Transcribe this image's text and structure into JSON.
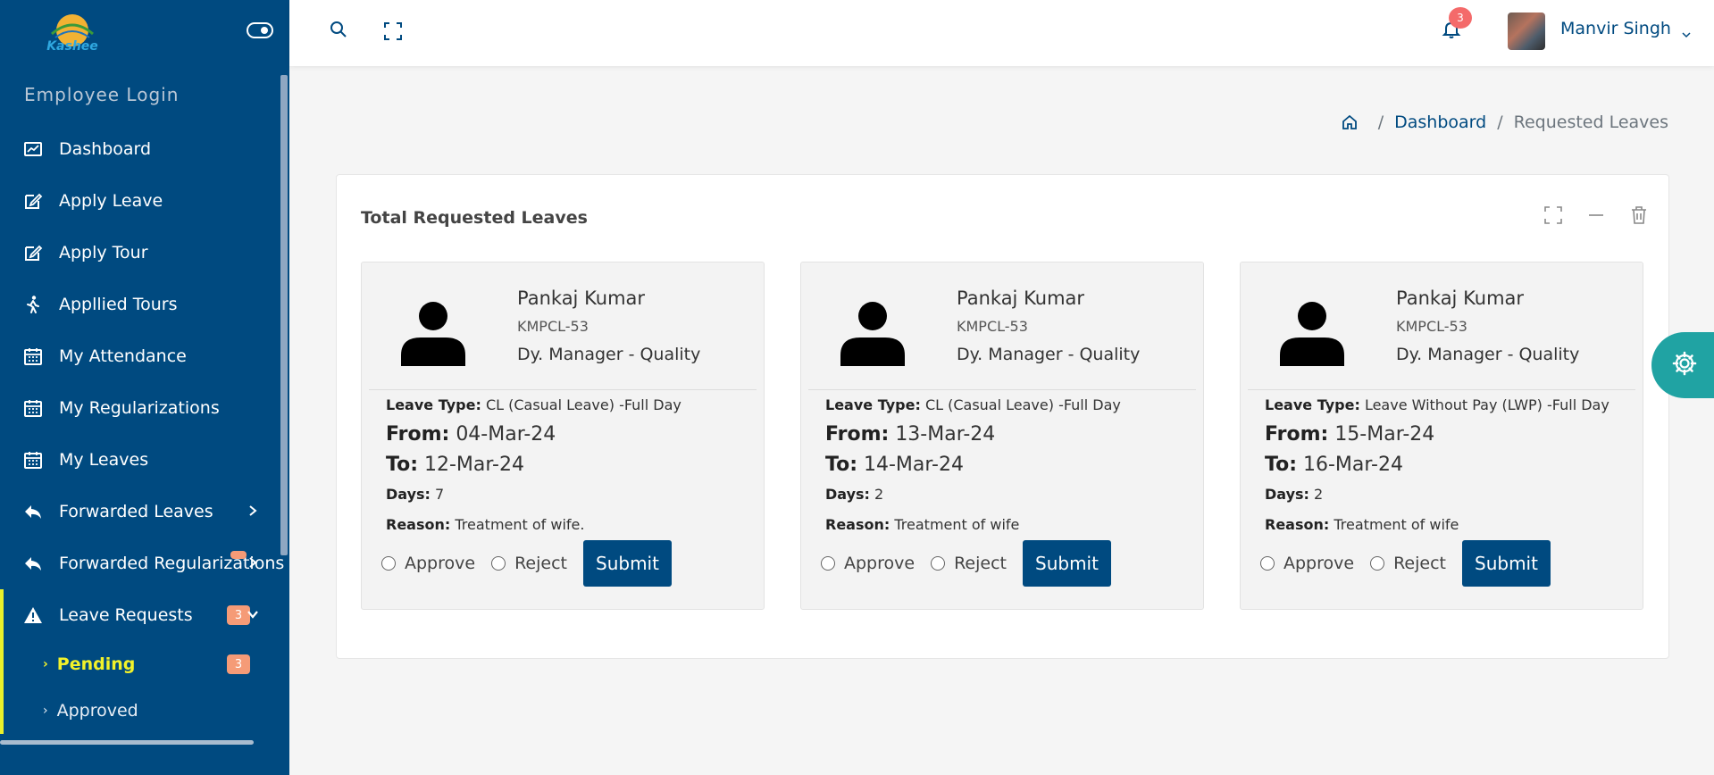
{
  "sidebar": {
    "logo_text": "Kashee",
    "section_label": "Employee Login",
    "items": [
      {
        "label": "Dashboard"
      },
      {
        "label": "Apply Leave"
      },
      {
        "label": "Apply Tour"
      },
      {
        "label": "Appllied Tours"
      },
      {
        "label": "My Attendance"
      },
      {
        "label": "My Regularizations"
      },
      {
        "label": "My Leaves"
      },
      {
        "label": "Forwarded Leaves"
      },
      {
        "label": "Forwarded Regularizations"
      },
      {
        "label": "Leave Requests",
        "badge": "3"
      }
    ],
    "sub_items": [
      {
        "label": "Pending",
        "badge": "3"
      },
      {
        "label": "Approved"
      }
    ]
  },
  "topbar": {
    "notification_count": "3",
    "user_name": "Manvir Singh"
  },
  "breadcrumb": {
    "items": [
      "Dashboard",
      "Requested Leaves"
    ]
  },
  "card": {
    "title": "Total Requested Leaves"
  },
  "labels": {
    "leave_type": "Leave Type:",
    "from": "From:",
    "to": "To:",
    "days": "Days:",
    "reason": "Reason:",
    "approve": "Approve",
    "reject": "Reject",
    "submit": "Submit"
  },
  "requests": [
    {
      "name": "Pankaj Kumar",
      "code": "KMPCL-53",
      "designation": "Dy. Manager - Quality",
      "leave_type": "CL (Casual Leave) -Full Day",
      "from": "04-Mar-24",
      "to": "12-Mar-24",
      "days": "7",
      "reason": "Treatment of wife."
    },
    {
      "name": "Pankaj Kumar",
      "code": "KMPCL-53",
      "designation": "Dy. Manager - Quality",
      "leave_type": "CL (Casual Leave) -Full Day",
      "from": "13-Mar-24",
      "to": "14-Mar-24",
      "days": "2",
      "reason": "Treatment of wife"
    },
    {
      "name": "Pankaj Kumar",
      "code": "KMPCL-53",
      "designation": "Dy. Manager - Quality",
      "leave_type": "Leave Without Pay (LWP) -Full Day",
      "from": "15-Mar-24",
      "to": "16-Mar-24",
      "days": "2",
      "reason": "Treatment of wife"
    }
  ],
  "colors": {
    "sidebar_bg": "#004a80",
    "active_accent": "#e9f02b",
    "badge": "#f59b77",
    "settings_tab": "#20a3a3",
    "notification_badge": "#f46a6a"
  }
}
